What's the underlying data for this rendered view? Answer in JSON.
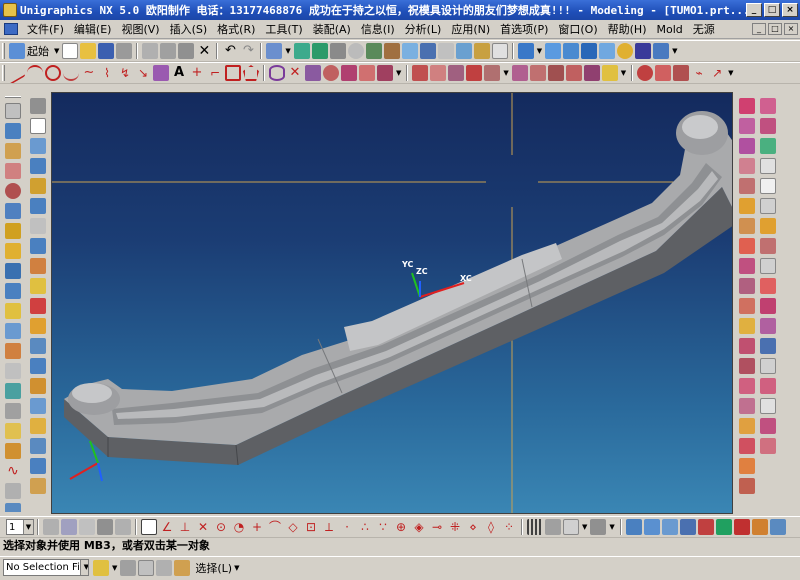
{
  "window": {
    "title": "Unigraphics NX 5.0 欧阳制作 电话：13177468876     成功在于持之以恒，祝模具设计的朋友们梦想成真!!! - Modeling - [TUMO1.prt...",
    "buttons": [
      "_",
      "□",
      "×"
    ]
  },
  "menu": {
    "items": [
      {
        "label": "文件(F)"
      },
      {
        "label": "编辑(E)"
      },
      {
        "label": "视图(V)"
      },
      {
        "label": "插入(S)"
      },
      {
        "label": "格式(R)"
      },
      {
        "label": "工具(T)"
      },
      {
        "label": "装配(A)"
      },
      {
        "label": "信息(I)"
      },
      {
        "label": "分析(L)"
      },
      {
        "label": "应用(N)"
      },
      {
        "label": "首选项(P)"
      },
      {
        "label": "窗口(O)"
      },
      {
        "label": "帮助(H)"
      },
      {
        "label": "Mold"
      },
      {
        "label": "无源"
      }
    ],
    "mdi_buttons": [
      "_",
      "□",
      "×"
    ]
  },
  "toolbar1": {
    "start_label": "起始"
  },
  "viewport": {
    "triad_labels": {
      "yc": "YC",
      "zc": "ZC",
      "xc": "XC"
    }
  },
  "bottombar": {
    "layer_value": "1"
  },
  "status": {
    "cue_line": "选择对象并使用 MB3，或者双击某一对象"
  },
  "selectionbar": {
    "filter_value": "No Selection Fi",
    "select_label": "选择(L)"
  },
  "colors": {
    "title_bar": "#1f4fb8",
    "viewport_top": "#142a5e",
    "viewport_bottom": "#3a86b4",
    "part_body": "#a9aaac",
    "chrome": "#d4d0c8"
  }
}
